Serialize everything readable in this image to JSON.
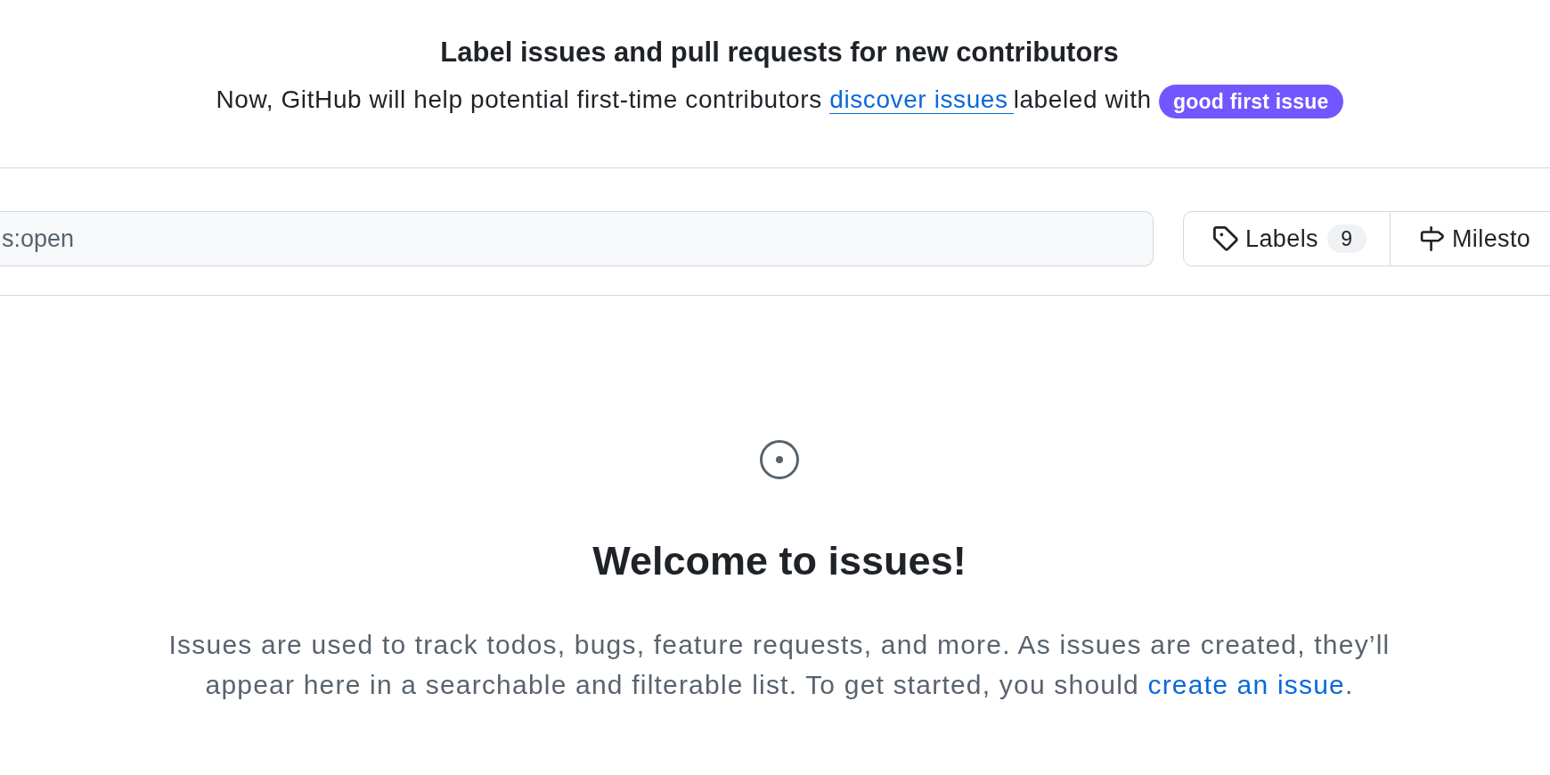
{
  "banner": {
    "title": "Label issues and pull requests for new contributors",
    "text_before": "Now, GitHub will help potential first-time contributors",
    "link": "discover issues",
    "text_after": "labeled with",
    "label": "good first issue"
  },
  "filter_bar": {
    "search": {
      "value": "s:open"
    },
    "buttons": [
      {
        "kind": "labels",
        "label": "Labels",
        "count": "9"
      },
      {
        "kind": "milestones",
        "label": "Milesto"
      }
    ]
  },
  "empty_state": {
    "heading": "Welcome to issues!",
    "text": "Issues are used to track todos, bugs, feature requests, and more. As issues are created, they’ll appear here in a searchable and filterable list. To get started, you should",
    "link": "create an issue",
    "text_end": "."
  }
}
